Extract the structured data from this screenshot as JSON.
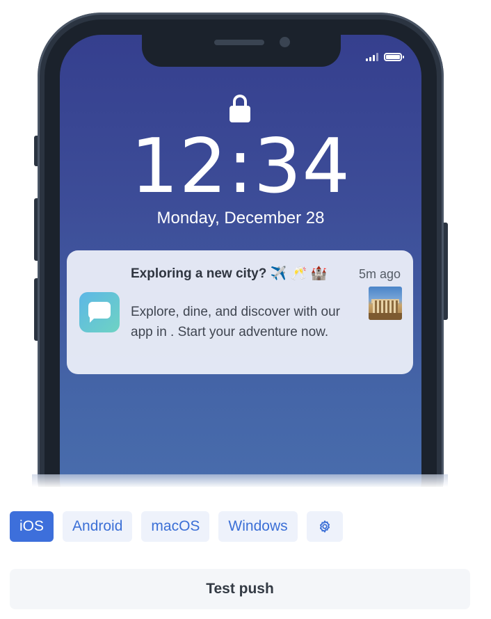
{
  "phone": {
    "status": {
      "signal_icon": "signal-bars-icon",
      "battery_icon": "battery-icon"
    },
    "lock_icon": "lock-icon",
    "time": "12:34",
    "date": "Monday, December 28"
  },
  "notification": {
    "app_icon": "chat-bubble-icon",
    "title": "Exploring a new city? ✈️ 🥂 🏰",
    "body": "Explore, dine, and discover with our app in . Start your adventure now.",
    "time": "5m ago",
    "thumbnail": "parthenon-image"
  },
  "platform_tabs": {
    "items": [
      "iOS",
      "Android",
      "macOS",
      "Windows"
    ],
    "active": "iOS",
    "settings_icon": "gear-icon"
  },
  "actions": {
    "test_push_label": "Test push"
  },
  "colors": {
    "accent": "#3d6fdb",
    "tab_bg": "#eef2fb",
    "screen_top": "#353f8e",
    "screen_bottom": "#4a6fae"
  }
}
